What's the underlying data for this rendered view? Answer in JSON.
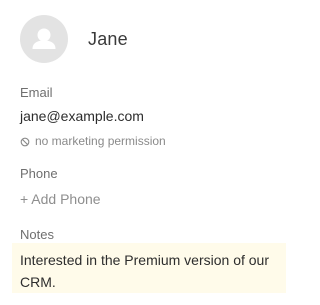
{
  "contact": {
    "name": "Jane"
  },
  "email": {
    "label": "Email",
    "value": "jane@example.com",
    "permission_text": "no marketing permission"
  },
  "phone": {
    "label": "Phone",
    "add_text": "+ Add Phone"
  },
  "notes": {
    "label": "Notes",
    "text": "Interested in the Premium version of our CRM."
  },
  "icons": {
    "avatar": "user-avatar-icon",
    "permission": "no-permission-icon"
  },
  "colors": {
    "avatar_bg": "#e3e3e3",
    "notes_bg": "#fffbea",
    "muted_text": "#8a8a8a"
  }
}
